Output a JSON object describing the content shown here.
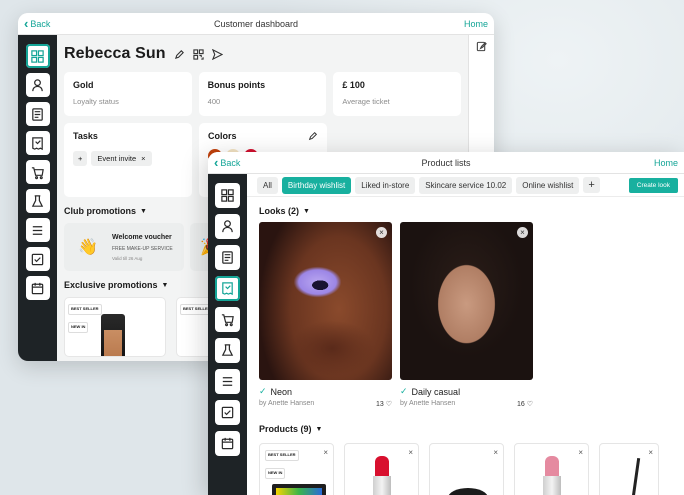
{
  "dashboard": {
    "back_label": "Back",
    "title": "Customer dashboard",
    "home_label": "Home",
    "customer_name": "Rebecca Sun",
    "cards": [
      {
        "title": "Gold",
        "subtitle": "Loyalty status"
      },
      {
        "title": "Bonus points",
        "subtitle": "400"
      },
      {
        "title": "£ 100",
        "subtitle": "Average ticket"
      }
    ],
    "tasks": {
      "title": "Tasks",
      "chip_add": "+",
      "chip_label": "Event invite",
      "chip_close": "×"
    },
    "colors": {
      "title": "Colors",
      "swatches": [
        "#c2410c",
        "#f3e3c3",
        "#d2102f"
      ]
    },
    "club_promotions": {
      "label": "Club promotions",
      "items": [
        {
          "icon": "👋",
          "title": "Welcome voucher",
          "detail": "FREE MAKE-UP SERVICE",
          "valid": "Valid till 26 Aug"
        },
        {
          "icon": "🎉",
          "title": "",
          "detail": "",
          "valid": ""
        }
      ]
    },
    "exclusive_promotions": {
      "label": "Exclusive promotions",
      "badge_best": "BEST SELLER",
      "badge_new": "NEW IN"
    }
  },
  "product_lists": {
    "back_label": "Back",
    "title": "Product lists",
    "home_label": "Home",
    "tabs": [
      "All",
      "Birthday wishlist",
      "Liked in-store",
      "Skincare service 10.02",
      "Online wishlist"
    ],
    "active_tab": "Birthday wishlist",
    "add_tab": "+",
    "create_label": "Create look",
    "looks_label": "Looks (2)",
    "looks": [
      {
        "name": "Neon",
        "author": "by Anette Hansen",
        "likes": "13"
      },
      {
        "name": "Daily casual",
        "author": "by Anette Hansen",
        "likes": "16"
      }
    ],
    "products_label": "Products (9)",
    "product_badges": {
      "best": "BEST SELLER",
      "new": "NEW IN"
    }
  },
  "colors": {
    "accent": "#18b09f",
    "sidebar": "#1e2326"
  }
}
